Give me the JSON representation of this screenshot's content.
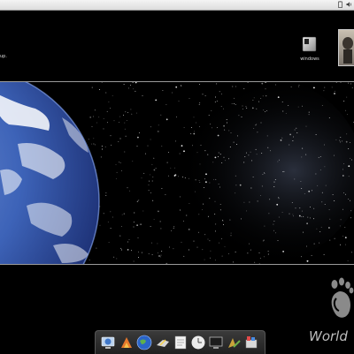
{
  "desktop": {
    "truncated_label": "up.",
    "windows_icon_label": "windows"
  },
  "footer": {
    "logo_text": "World"
  },
  "dock": {
    "items": [
      "globe-screen-icon",
      "gift-icon",
      "earth-icon",
      "camera-icon",
      "document-icon",
      "clock-icon",
      "monitor-icon",
      "paint-icon",
      "package-icon"
    ]
  },
  "colors": {
    "background": "#000000",
    "topbar": "#e6e6e6",
    "earth_blue": "#3d63b8"
  }
}
